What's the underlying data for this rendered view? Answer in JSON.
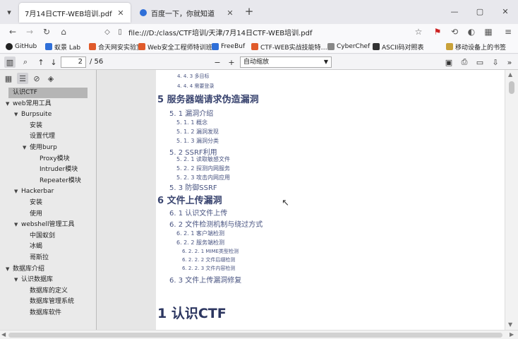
{
  "tabs": [
    {
      "title": "7月14日CTF-WEB培训.pdf",
      "close": "✕"
    },
    {
      "title": "百度一下，你就知道",
      "close": "✕"
    }
  ],
  "new_tab": "+",
  "window_controls": [
    "—",
    "▢",
    "✕"
  ],
  "address": {
    "url": "file:///D:/class/CTF培训/天津/7月14日CTF-WEB培训.pdf"
  },
  "bookmarks": [
    {
      "label": "GitHub",
      "color": "#222222"
    },
    {
      "label": "蚁景 Lab",
      "color": "#2f6fd8"
    },
    {
      "label": "合天网安实验室",
      "color": "#e05a2a"
    },
    {
      "label": "Web安全工程师特训班",
      "color": "#e05a2a"
    },
    {
      "label": "FreeBuf",
      "color": "#2f6fd8"
    },
    {
      "label": "CTF-WEB实战技能特…",
      "color": "#e05a2a"
    },
    {
      "label": "CyberChef",
      "color": "#888888"
    },
    {
      "label": "ASCII码对照表",
      "color": "#333333"
    }
  ],
  "mobile_bookmarks": "移动设备上的书签",
  "pdf_toolbar": {
    "page_number": "2",
    "page_count": "/ 56",
    "zoom": "自动缩放"
  },
  "outline": [
    {
      "label": "认识CTF",
      "depth": 0,
      "twisty": "",
      "selected": true
    },
    {
      "label": "web常用工具",
      "depth": 0,
      "twisty": "▼"
    },
    {
      "label": "Burpsuite",
      "depth": 1,
      "twisty": "▼"
    },
    {
      "label": "安装",
      "depth": 2,
      "twisty": ""
    },
    {
      "label": "设置代理",
      "depth": 2,
      "twisty": ""
    },
    {
      "label": "使用burp",
      "depth": 2,
      "twisty": "▼"
    },
    {
      "label": "Proxy模块",
      "depth": 3,
      "twisty": ""
    },
    {
      "label": "Intruder模块",
      "depth": 3,
      "twisty": ""
    },
    {
      "label": "Repeater模块",
      "depth": 3,
      "twisty": ""
    },
    {
      "label": "Hackerbar",
      "depth": 1,
      "twisty": "▼"
    },
    {
      "label": "安装",
      "depth": 2,
      "twisty": ""
    },
    {
      "label": "使用",
      "depth": 2,
      "twisty": ""
    },
    {
      "label": "webshell管理工具",
      "depth": 1,
      "twisty": "▼"
    },
    {
      "label": "中国蚁剑",
      "depth": 2,
      "twisty": ""
    },
    {
      "label": "冰蝎",
      "depth": 2,
      "twisty": ""
    },
    {
      "label": "哥斯拉",
      "depth": 2,
      "twisty": ""
    },
    {
      "label": "数据库介绍",
      "depth": 0,
      "twisty": "▼"
    },
    {
      "label": "认识数据库",
      "depth": 1,
      "twisty": "▼"
    },
    {
      "label": "数据库的定义",
      "depth": 2,
      "twisty": ""
    },
    {
      "label": "数据库管理系统",
      "depth": 2,
      "twisty": ""
    },
    {
      "label": "数据库软件",
      "depth": 2,
      "twisty": ""
    }
  ],
  "toc": [
    {
      "text": "4. 4. 3 多目标",
      "level": 4
    },
    {
      "text": "4. 4. 4 需要登录",
      "level": 4
    },
    {
      "text": "5 服务器端请求伪造漏洞",
      "level": 1
    },
    {
      "text": "5. 1 漏洞介绍",
      "level": 2
    },
    {
      "text": "5. 1. 1 概念",
      "level": 3
    },
    {
      "text": "5. 1. 2 漏洞发现",
      "level": 3
    },
    {
      "text": "5. 1. 3 漏洞分类",
      "level": 3
    },
    {
      "text": "5. 2 SSRF利用",
      "level": 2
    },
    {
      "text": "5. 2. 1 读取敏感文件",
      "level": 3
    },
    {
      "text": "5. 2. 2 探测内网服务",
      "level": 3
    },
    {
      "text": "5. 2. 3 攻击内网应用",
      "level": 3
    },
    {
      "text": "5. 3 防御SSRF",
      "level": 2
    },
    {
      "text": "6 文件上传漏洞",
      "level": 1
    },
    {
      "text": "6. 1 认识文件上传",
      "level": 2
    },
    {
      "text": "6. 2 文件检测机制与绕过方式",
      "level": 2
    },
    {
      "text": "6. 2. 1 客户端检测",
      "level": 3
    },
    {
      "text": "6. 2. 2 服务端检测",
      "level": 3
    },
    {
      "text": "6. 2. 2. 1 MIME类型检测",
      "level": 4
    },
    {
      "text": "6. 2. 2. 2 文件后缀检测",
      "level": 4
    },
    {
      "text": "6. 2. 2. 3 文件内容检测",
      "level": 4
    },
    {
      "text": "6. 3 文件上传漏洞修复",
      "level": 2
    }
  ],
  "page_heading": "1 认识CTF"
}
